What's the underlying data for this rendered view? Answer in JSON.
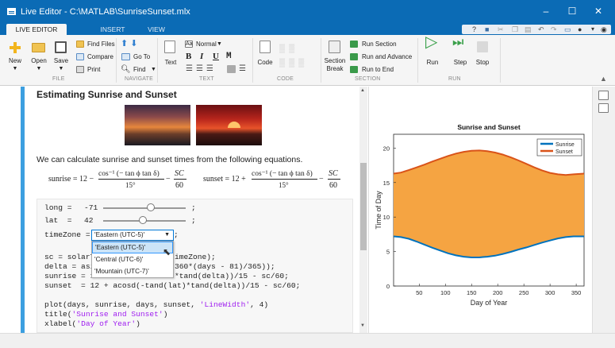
{
  "window": {
    "title": "Live Editor - C:\\MATLAB\\SunriseSunset.mlx",
    "buttons": [
      "–",
      "☐",
      "✕"
    ]
  },
  "tabs": [
    {
      "label": "LIVE EDITOR"
    },
    {
      "label": "INSERT"
    },
    {
      "label": "VIEW"
    }
  ],
  "ribbon": {
    "file": {
      "new": "New",
      "open": "Open",
      "save": "Save",
      "find_files": "Find Files",
      "compare": "Compare",
      "print": "Print",
      "section": "FILE"
    },
    "navigate": {
      "go_to": "Go To",
      "find": "Find",
      "section": "NAVIGATE"
    },
    "text": {
      "text_btn": "Text",
      "style": "Normal",
      "bold": "B",
      "italic": "I",
      "underline": "U",
      "mono": "M",
      "section": "TEXT"
    },
    "code": {
      "code_btn": "Code",
      "section": "CODE"
    },
    "section": {
      "section_break_1": "Section",
      "section_break_2": "Break",
      "run_section": "Run Section",
      "run_and_advance": "Run and Advance",
      "run_to_end": "Run to End",
      "section": "SECTION"
    },
    "run": {
      "run": "Run",
      "step": "Step",
      "stop": "Stop",
      "section": "RUN"
    }
  },
  "doc": {
    "heading": "Estimating Sunrise and Sunset",
    "paragraph": "We can calculate sunrise and sunset times from the following equations.",
    "eq_sunrise_lhs": "sunrise = 12 −",
    "eq_sunrise_num": "cos⁻¹ (− tan ϕ tan δ)",
    "eq_sunset_lhs": "sunset = 12 +",
    "eq_den_15": "15°",
    "eq_sc": "SC",
    "eq_60": "60",
    "eq_minus": "−"
  },
  "code": {
    "long_label": "long =",
    "long_value": "-71",
    "lat_label": "lat  =",
    "lat_value": "42",
    "semicolon": ";",
    "timezone_label": "timeZone =",
    "timezone_selected": "'Eastern (UTC-5)'",
    "timezone_options": [
      "'Eastern (UTC-5)'",
      "'Central (UTC-6)'",
      "'Mountain (UTC-7)'"
    ],
    "line_sc": "sc = solarT",
    "line_sc_tail": "imeZone);",
    "line_delta": "delta = asi",
    "line_delta_tail": "360*(days - 81)/365));",
    "line_sunrise": "sunrise = 1",
    "line_sunrise_tail": "*tand(delta))/15 - sc/60;",
    "line_sunset": "sunset  = 12 + acosd(-tand(lat)*tand(delta))/15 - sc/60;",
    "line_plot_1": "plot(days, sunrise, days, sunset, ",
    "line_plot_str": "'LineWidth'",
    "line_plot_2": ", 4)",
    "line_title_1": "title(",
    "line_title_str": "'Sunrise and Sunset'",
    "line_title_2": ")",
    "line_xlabel_1": "xlabel(",
    "line_xlabel_str": "'Day of Year'",
    "line_xlabel_2": ")"
  },
  "chart_data": {
    "type": "area",
    "title": "Sunrise and Sunset",
    "xlabel": "Day of Year",
    "ylabel": "Time of Day",
    "xlim": [
      1,
      365
    ],
    "ylim": [
      0,
      22
    ],
    "xticks": [
      50,
      100,
      150,
      200,
      250,
      300,
      350
    ],
    "yticks": [
      0,
      5,
      10,
      15,
      20
    ],
    "legend_position": "top-right",
    "x": [
      1,
      15,
      30,
      45,
      60,
      75,
      90,
      105,
      120,
      135,
      150,
      165,
      172,
      180,
      195,
      210,
      225,
      240,
      255,
      270,
      285,
      300,
      315,
      330,
      345,
      365
    ],
    "series": [
      {
        "name": "Sunrise",
        "color": "#0072bd",
        "values": [
          7.2,
          7.1,
          6.85,
          6.45,
          6.0,
          5.55,
          5.15,
          4.75,
          4.45,
          4.25,
          4.15,
          4.15,
          4.2,
          4.25,
          4.4,
          4.65,
          4.95,
          5.3,
          5.6,
          5.95,
          6.3,
          6.6,
          6.9,
          7.1,
          7.2,
          7.2
        ]
      },
      {
        "name": "Sunset",
        "color": "#d95319",
        "values": [
          16.3,
          16.45,
          16.8,
          17.2,
          17.6,
          18.05,
          18.45,
          18.85,
          19.2,
          19.45,
          19.6,
          19.65,
          19.6,
          19.55,
          19.35,
          19.05,
          18.65,
          18.2,
          17.7,
          17.2,
          16.75,
          16.4,
          16.2,
          16.1,
          16.2,
          16.3
        ]
      }
    ],
    "fill_color": "#f5a442"
  }
}
